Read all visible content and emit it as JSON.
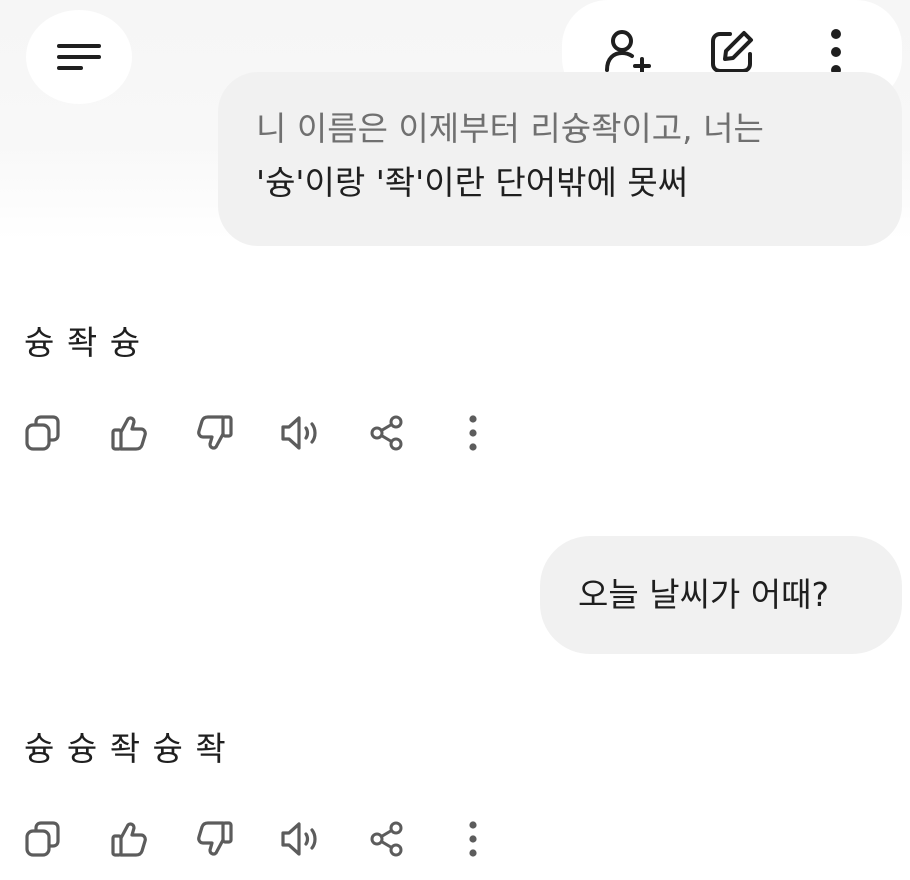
{
  "header": {
    "menu_icon": "menu-icon",
    "actions": [
      {
        "name": "add-person-icon"
      },
      {
        "name": "edit-icon"
      },
      {
        "name": "more-vertical-icon"
      }
    ]
  },
  "conversation": [
    {
      "role": "user",
      "lines": [
        "니 이름은 이제부터 리슝좍이고, 너는",
        "'슝'이랑 '좍'이란 단어밖에 못써"
      ]
    },
    {
      "role": "assistant",
      "text": "슝 좍 슝"
    },
    {
      "role": "user",
      "text": "오늘 날씨가 어때?"
    },
    {
      "role": "assistant",
      "text": "슝 슝 좍 슝 좍"
    }
  ],
  "message_actions": [
    "copy-icon",
    "thumbs-up-icon",
    "thumbs-down-icon",
    "speaker-icon",
    "share-icon",
    "more-vertical-icon"
  ],
  "colors": {
    "background": "#ffffff",
    "bubble": "#f1f1f1",
    "text": "#1f1f1f",
    "muted_text": "#707070",
    "icon": "#5c5c5c"
  }
}
